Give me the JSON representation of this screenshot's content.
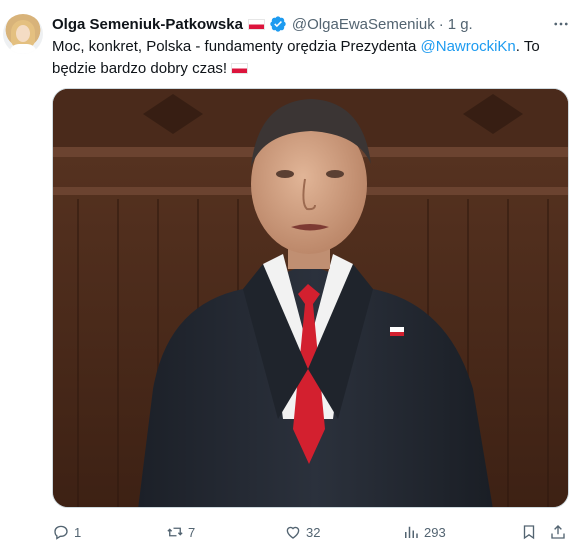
{
  "author": {
    "name": "Olga Semeniuk-Patkowska",
    "handle": "@OlgaEwaSemeniuk",
    "separator": "·",
    "time": "1 g."
  },
  "tweet": {
    "text_before": "Moc, konkret, Polska - fundamenty orędzia Prezydenta ",
    "mention": "@NawrockiKn",
    "text_after": ". To będzie bardzo dobry czas!"
  },
  "stats": {
    "replies": "1",
    "retweets": "7",
    "likes": "32",
    "views": "293"
  },
  "colors": {
    "text": "#0f1419",
    "secondary": "#536471",
    "link": "#1d9bf0",
    "tie": "#d3202f"
  },
  "icons": [
    "more-icon",
    "verified-icon",
    "flag-icon",
    "reply-icon",
    "retweet-icon",
    "like-icon",
    "views-icon",
    "bookmark-icon",
    "share-icon"
  ]
}
